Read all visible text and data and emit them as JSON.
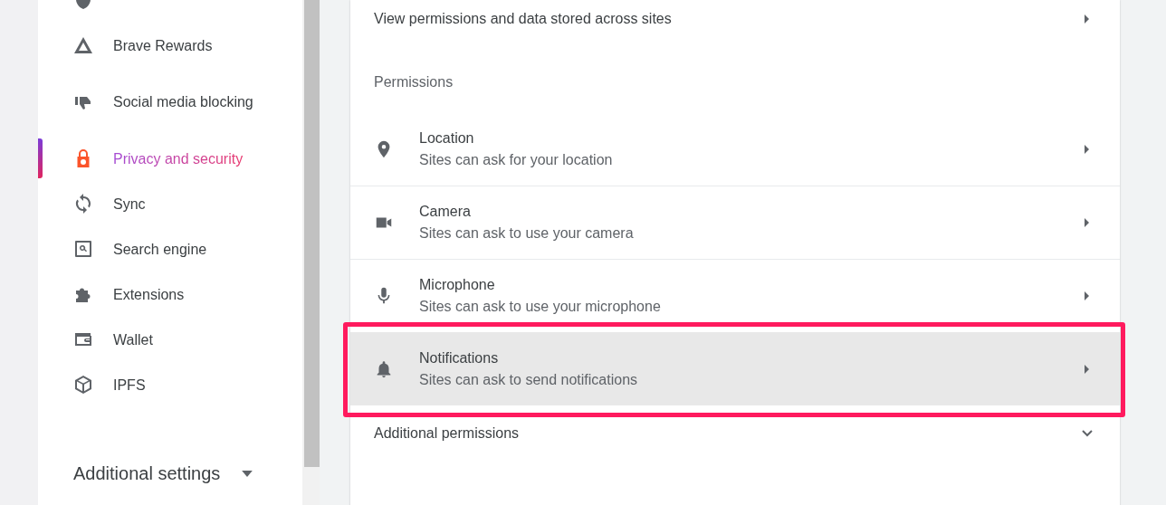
{
  "sidebar": {
    "items": [
      {
        "label": "Brave Rewards",
        "selected": false
      },
      {
        "label": "Social media blocking",
        "selected": false
      },
      {
        "label": "Privacy and security",
        "selected": true
      },
      {
        "label": "Sync",
        "selected": false
      },
      {
        "label": "Search engine",
        "selected": false
      },
      {
        "label": "Extensions",
        "selected": false
      },
      {
        "label": "Wallet",
        "selected": false
      },
      {
        "label": "IPFS",
        "selected": false
      }
    ],
    "additional": {
      "label": "Additional settings",
      "expanded": false
    }
  },
  "card": {
    "site_settings_row": {
      "label": "View permissions and data stored across sites"
    },
    "permissions_heading": "Permissions",
    "permissions": [
      {
        "title": "Location",
        "subtitle": "Sites can ask for your location",
        "highlighted": false
      },
      {
        "title": "Camera",
        "subtitle": "Sites can ask to use your camera",
        "highlighted": false
      },
      {
        "title": "Microphone",
        "subtitle": "Sites can ask to use your microphone",
        "highlighted": false
      },
      {
        "title": "Notifications",
        "subtitle": "Sites can ask to send notifications",
        "highlighted": true
      }
    ],
    "additional_permissions": {
      "label": "Additional permissions",
      "expanded": false
    }
  }
}
